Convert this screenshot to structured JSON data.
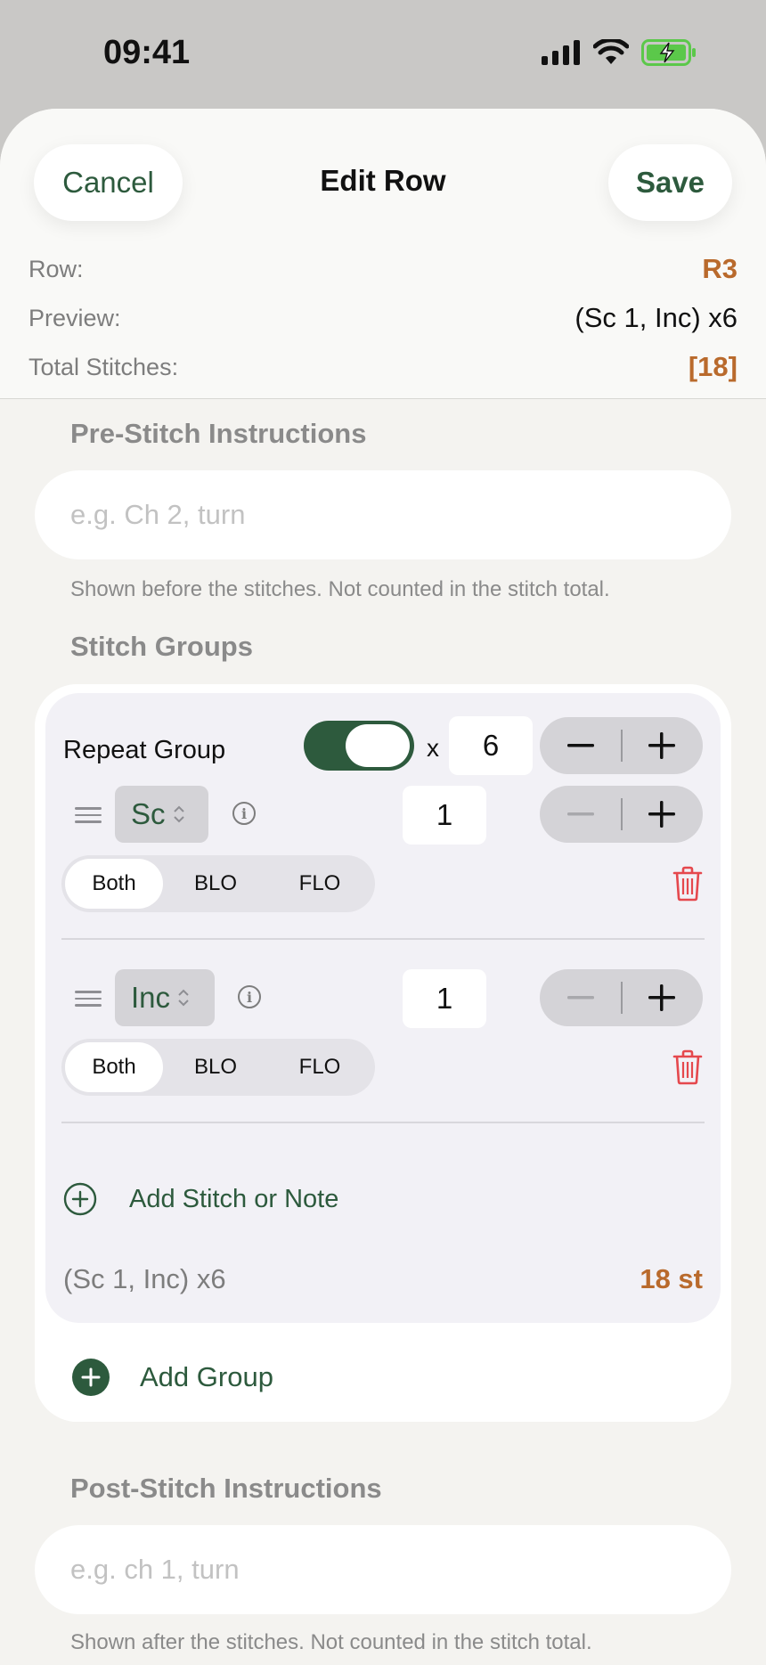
{
  "status": {
    "time": "09:41"
  },
  "nav": {
    "cancel": "Cancel",
    "title": "Edit Row",
    "save": "Save"
  },
  "info": {
    "row_label": "Row:",
    "row_value": "R3",
    "preview_label": "Preview:",
    "preview_value": "(Sc 1, Inc) x6",
    "total_label": "Total Stitches:",
    "total_value": "[18]"
  },
  "pre": {
    "title": "Pre-Stitch Instructions",
    "placeholder": "e.g. Ch 2, turn",
    "help": "Shown before the stitches. Not counted in the stitch total."
  },
  "groups": {
    "title": "Stitch Groups",
    "repeat_label": "Repeat Group",
    "repeat_enabled": true,
    "x_label": "x",
    "repeat_count": "6",
    "stitches": [
      {
        "name": "Sc",
        "count": "1",
        "loops": [
          "Both",
          "BLO",
          "FLO"
        ],
        "selected": "Both"
      },
      {
        "name": "Inc",
        "count": "1",
        "loops": [
          "Both",
          "BLO",
          "FLO"
        ],
        "selected": "Both"
      }
    ],
    "add_stitch": "Add Stitch or Note",
    "summary": "(Sc 1, Inc) x6",
    "summary_count": "18 st",
    "add_group": "Add Group"
  },
  "post": {
    "title": "Post-Stitch Instructions",
    "placeholder": "e.g. ch 1, turn",
    "help": "Shown after the stitches. Not counted in the stitch total."
  },
  "colors": {
    "accent_green": "#2d5a3d",
    "accent_orange": "#b96a2c",
    "delete_red": "#e5484d"
  }
}
